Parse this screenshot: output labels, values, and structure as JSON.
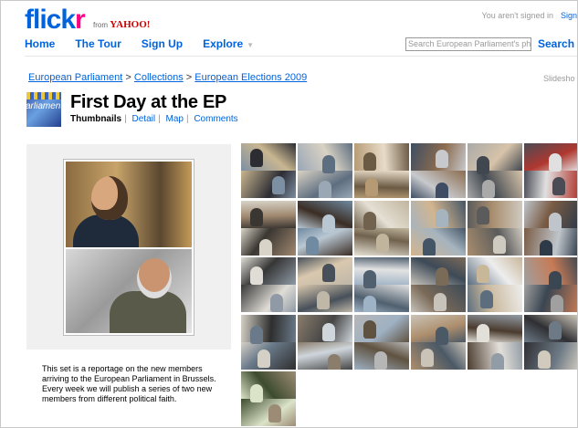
{
  "header": {
    "logo_main": "flick",
    "logo_r": "r",
    "from": "from",
    "yahoo": "YAHOO!",
    "signin_prompt": "You aren't signed in",
    "signin_link": "Sign",
    "nav": [
      "Home",
      "The Tour",
      "Sign Up",
      "Explore"
    ],
    "search_placeholder": "Search European Parliament's pho",
    "search_button": "Search"
  },
  "breadcrumb": {
    "items": [
      "European Parliament",
      "Collections",
      "European Elections 2009"
    ],
    "separator": ">"
  },
  "slideshow_label": "Slidesho",
  "set_icon_text": "arliament",
  "set": {
    "title": "First Day at the EP",
    "tabs": [
      "Thumbnails",
      "Detail",
      "Map",
      "Comments"
    ],
    "description": "This set is a reportage on the new members arriving to the European Parliament in Brussels. Every week we will publish a series of two new members from different political faith."
  },
  "colors": {
    "link_blue": "#0063dc",
    "flickr_pink": "#ff0084",
    "panel_gray": "#f0f0f0"
  },
  "thumbnails": [
    {
      "name": "thumb-1"
    },
    {
      "name": "thumb-2"
    },
    {
      "name": "thumb-3"
    },
    {
      "name": "thumb-4"
    },
    {
      "name": "thumb-5"
    },
    {
      "name": "thumb-6"
    },
    {
      "name": "thumb-7"
    },
    {
      "name": "thumb-8"
    },
    {
      "name": "thumb-9"
    },
    {
      "name": "thumb-10"
    },
    {
      "name": "thumb-11"
    },
    {
      "name": "thumb-12"
    },
    {
      "name": "thumb-13"
    },
    {
      "name": "thumb-14"
    },
    {
      "name": "thumb-15"
    },
    {
      "name": "thumb-16"
    },
    {
      "name": "thumb-17"
    },
    {
      "name": "thumb-18"
    },
    {
      "name": "thumb-19"
    },
    {
      "name": "thumb-20"
    },
    {
      "name": "thumb-21"
    },
    {
      "name": "thumb-22"
    },
    {
      "name": "thumb-23"
    },
    {
      "name": "thumb-24"
    },
    {
      "name": "thumb-25"
    }
  ]
}
